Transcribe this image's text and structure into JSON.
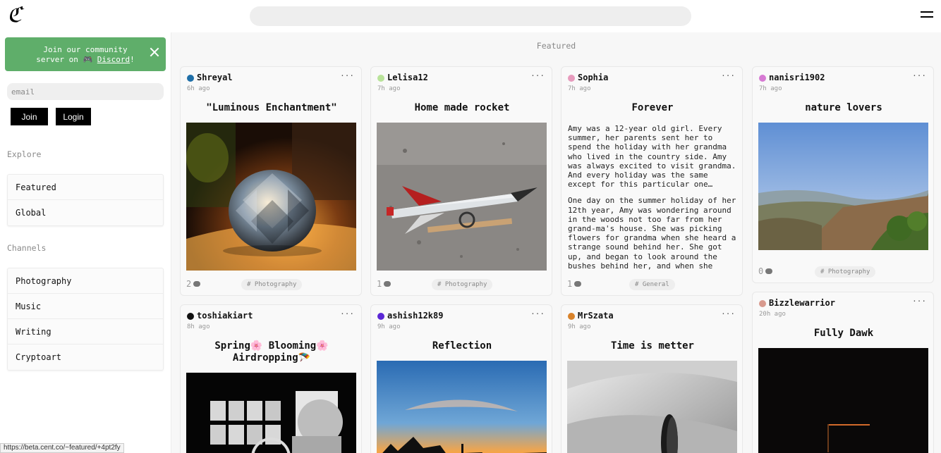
{
  "header": {
    "logo": "ℭ",
    "search_placeholder": ""
  },
  "sidebar": {
    "discord_banner": {
      "line1": "Join our community",
      "line2_prefix": "server on 🎮 ",
      "link": "Discord",
      "line2_suffix": "!"
    },
    "email_placeholder": "email",
    "join_label": "Join",
    "login_label": "Login",
    "explore_label": "Explore",
    "explore_items": [
      "Featured",
      "Global"
    ],
    "channels_label": "Channels",
    "channel_items": [
      "Photography",
      "Music",
      "Writing",
      "Cryptoart"
    ]
  },
  "main": {
    "heading": "Featured",
    "cards": [
      {
        "user": "Shreyal",
        "time": "6h ago",
        "title": "\"Luminous Enchantment\"",
        "count": "2",
        "tag": "# Photography",
        "dot_color": "#1f6fa8"
      },
      {
        "user": "Lelisa12",
        "time": "7h ago",
        "title": "Home made rocket",
        "count": "1",
        "tag": "# Photography",
        "dot_color": "#b9e39a"
      },
      {
        "user": "Sophia",
        "time": "7h ago",
        "title": "Forever",
        "count": "1",
        "tag": "# General",
        "dot_color": "#e79bbd",
        "p1": "Amy was a 12-year old girl. Every summer, her parents sent her to spend the holiday with her grandma who lived in the country side. Amy was always excited to visit grandma. And every holiday was the same except for this particular one…",
        "p2": "One day on the summer holiday of her 12th year, Amy was wondering around in the woods not too far from her grand-ma's house. She was picking flowers for grandma when she heard a strange sound behind her. She got up, and began to look around the bushes behind her, and when she looked up,"
      },
      {
        "user": "nanisri1902",
        "time": "7h ago",
        "title": "nature lovers",
        "count": "0",
        "tag": "# Photography",
        "dot_color": "#d67ad3"
      },
      {
        "user": "toshiakiart",
        "time": "8h ago",
        "title": "Spring🌸 Blooming🌸 Airdropping🪂",
        "dot_color": "#111111"
      },
      {
        "user": "ashish12k89",
        "time": "9h ago",
        "title": "Reflection",
        "dot_color": "#5b27d6"
      },
      {
        "user": "MrSzata",
        "time": "9h ago",
        "title": "Time is metter",
        "dot_color": "#d9832b"
      },
      {
        "user": "Bizzlewarrior",
        "time": "20h ago",
        "title": "Fully Dawk",
        "dot_color": "#d89a8e"
      }
    ]
  },
  "status_url": "https://beta.cent.co/~featured/+4pt2fy"
}
